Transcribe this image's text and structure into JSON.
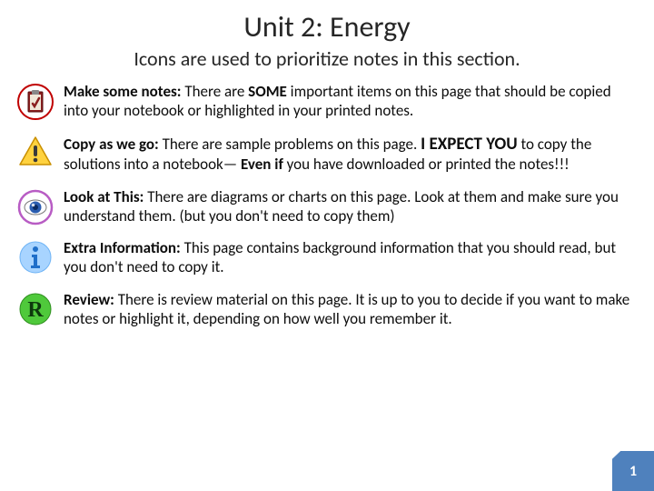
{
  "header": {
    "title": "Unit 2: Energy",
    "subtitle": "Icons are used to prioritize notes in this section."
  },
  "items": [
    {
      "label": "Make some notes:",
      "text_a": "  There are ",
      "bold_a": "SOME",
      "text_b": " important items on this page that should be copied into your notebook or highlighted in your printed notes."
    },
    {
      "label": "Copy as we go:",
      "text_a": "  There are sample problems on this page.  ",
      "big": "I EXPECT YOU",
      "text_b": " to copy the solutions into a notebook— ",
      "bold_b": "Even if",
      "text_c": " you have downloaded or printed the notes!!!"
    },
    {
      "label": "Look at This:",
      "text_a": "  There are diagrams or charts on this page.  Look at them and make sure you understand them.  (but you don't need to copy them)"
    },
    {
      "label": "Extra Information:",
      "text_a": "  This page contains background information that you should read, but you don't need to copy it."
    },
    {
      "label": "Review:",
      "text_a": "  There is review material on this page.  It is up to you to decide if you want to make notes or highlight it, depending on how well you remember it."
    }
  ],
  "page_number": "1"
}
